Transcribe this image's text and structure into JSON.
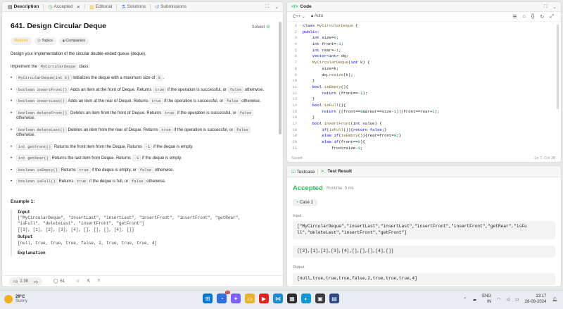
{
  "left_tabs": [
    {
      "icon": "document-icon",
      "label": "Description"
    },
    {
      "icon": "check-icon",
      "label": "Accepted"
    },
    {
      "icon": "book-icon",
      "label": "Editorial"
    },
    {
      "icon": "flask-icon",
      "label": "Solutions"
    },
    {
      "icon": "history-icon",
      "label": "Submissions"
    }
  ],
  "problem": {
    "title": "641. Design Circular Deque",
    "status": "Solved",
    "difficulty": "Medium",
    "chips": [
      "Topics",
      "Companies"
    ],
    "intro": "Design your implementation of the circular double-ended queue (deque).",
    "implement_prefix": "Implement the ",
    "class_name": "MyCircularDeque",
    "implement_suffix": " class:",
    "methods": [
      {
        "code": "MyCircularDeque(int k)",
        "text": " Initializes the deque with a maximum size of ",
        "code2": "k",
        "text2": "."
      },
      {
        "code": "boolean insertFront()",
        "text": " Adds an item at the front of Deque. Returns ",
        "code2": "true",
        "text2": " if the operation is successful, or ",
        "code3": "false",
        "text3": " otherwise."
      },
      {
        "code": "boolean insertLast()",
        "text": " Adds an item at the rear of Deque. Returns ",
        "code2": "true",
        "text2": " if the operation is successful, or ",
        "code3": "false",
        "text3": " otherwise."
      },
      {
        "code": "boolean deleteFront()",
        "text": " Deletes an item from the front of Deque. Returns ",
        "code2": "true",
        "text2": " if the operation is successful, or ",
        "code3": "false",
        "text3": " otherwise."
      },
      {
        "code": "boolean deleteLast()",
        "text": " Deletes an item from the rear of Deque. Returns ",
        "code2": "true",
        "text2": " if the operation is successful, or ",
        "code3": "false",
        "text3": " otherwise."
      },
      {
        "code": "int getFront()",
        "text": " Returns the front item from the Deque. Returns ",
        "code2": "-1",
        "text2": " if the deque is empty."
      },
      {
        "code": "int getRear()",
        "text": " Returns the last item from Deque. Returns ",
        "code2": "-1",
        "text2": " if the deque is empty."
      },
      {
        "code": "boolean isEmpty()",
        "text": " Returns ",
        "code2": "true",
        "text2": " if the deque is empty, or ",
        "code3": "false",
        "text3": " otherwise."
      },
      {
        "code": "boolean isFull()",
        "text": " Returns ",
        "code2": "true",
        "text2": " if the deque is full, or ",
        "code3": "false",
        "text3": " otherwise."
      }
    ],
    "example_title": "Example 1:",
    "example": {
      "input_label": "Input",
      "input_line1": "[\"MyCircularDeque\", \"insertLast\", \"insertLast\", \"insertFront\", \"insertFront\", \"getRear\",",
      "input_line2": "\"isFull\", \"deleteLast\", \"insertFront\", \"getFront\"]",
      "input_line3": "[[3], [1], [2], [3], [4], [], [], [], [4], []]",
      "output_label": "Output",
      "output_line": "[null, true, true, true, false, 2, true, true, true, 4]",
      "explanation_label": "Explanation"
    },
    "likes": "1.3K",
    "comments": "61"
  },
  "code_panel": {
    "title": "Code",
    "language": "C++",
    "mode": "Auto",
    "status_left": "Saved",
    "status_right": "Ln 7, Col 28"
  },
  "code_lines": [
    "class MyCircularDeque {",
    "public:",
    "    int size=0;",
    "    int front=-1;",
    "    int rear=-1;",
    "    vector<int> dq;",
    "    MyCircularDeque(int k) {",
    "        size=k;",
    "        dq.resize(k);",
    "    }",
    "    bool isEmpty(){",
    "        return (front==-1);",
    "    }",
    "    bool isFull(){",
    "        return ((front==0&&rear==size-1)||front==rear+1);",
    "    }",
    "    bool insertFront(int value) {",
    "        if(isFull()){return false;}",
    "        else if(isEmpty()){rear=front=0;}",
    "        else if(front==0){",
    "            front=size-1;"
  ],
  "test_panel": {
    "tab_testcase": "Testcase",
    "tab_result": "Test Result",
    "verdict": "Accepted",
    "runtime": "Runtime: 0 ms",
    "case": "Case 1",
    "input_label": "Input",
    "input_line1": "[\"MyCircularDeque\",\"insertLast\",\"insertLast\",\"insertFront\",\"insertFront\",\"getRear\",\"isFu",
    "input_line2": "ll\",\"deleteLast\",\"insertFront\",\"getFront\"]",
    "input_line3": "[[3],[1],[2],[3],[4],[],[],[],[4],[]]",
    "output_label": "Output",
    "output_line": "[null,true,true,true,false,2,true,true,true,4]"
  },
  "taskbar": {
    "temp": "29°C",
    "weather": "Sunny",
    "lang1": "ENG",
    "lang2": "IN",
    "time": "13:17",
    "date": "28-09-2024",
    "badge": "72"
  }
}
